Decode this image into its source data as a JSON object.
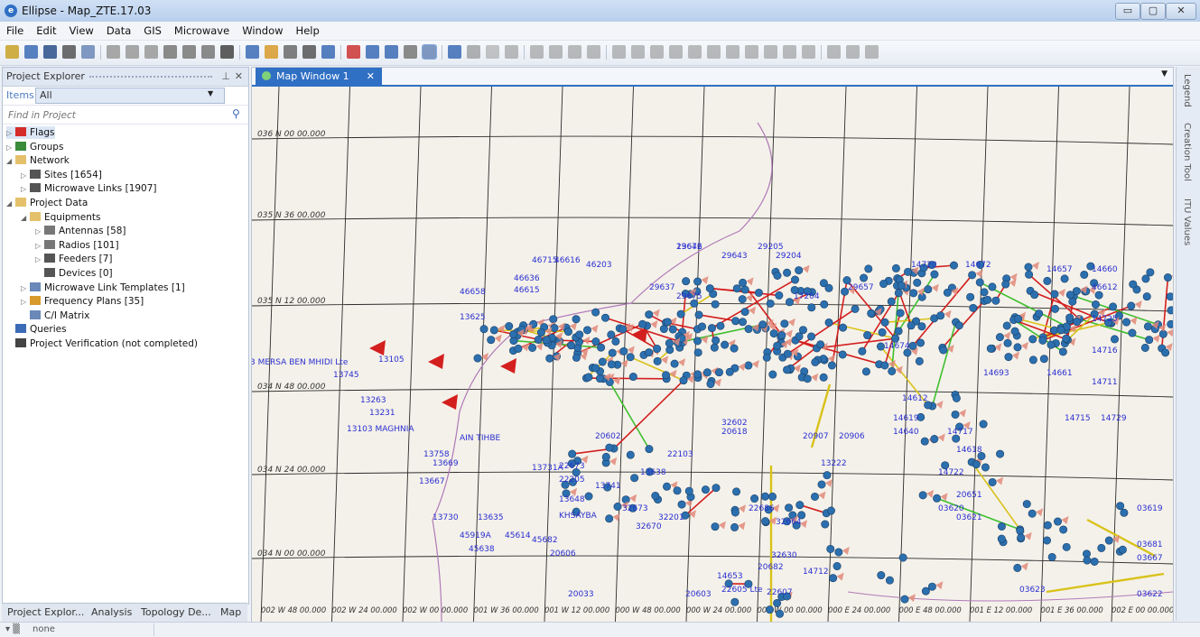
{
  "window": {
    "title": "Ellipse - Map_ZTE.17.03",
    "minimize": "▭",
    "restore": "▢",
    "close": "✕"
  },
  "menu": [
    "File",
    "Edit",
    "View",
    "Data",
    "GIS",
    "Microwave",
    "Window",
    "Help"
  ],
  "project_explorer": {
    "title": "Project Explorer",
    "items_label": "Items",
    "items_value": "All",
    "find_placeholder": "Find in Project",
    "tree": [
      {
        "label": "Flags",
        "icon": "flag-icon",
        "level": 0,
        "expanded": false,
        "selected": true
      },
      {
        "label": "Groups",
        "icon": "groups-icon",
        "level": 0,
        "expanded": false
      },
      {
        "label": "Network",
        "icon": "folder-icon",
        "level": 0,
        "expanded": true
      },
      {
        "label": "Sites [1654]",
        "icon": "site-icon",
        "level": 1,
        "expanded": false
      },
      {
        "label": "Microwave Links [1907]",
        "icon": "link-icon",
        "level": 1,
        "expanded": false
      },
      {
        "label": "Project Data",
        "icon": "folder-icon",
        "level": 0,
        "expanded": true
      },
      {
        "label": "Equipments",
        "icon": "folder-icon",
        "level": 1,
        "expanded": true
      },
      {
        "label": "Antennas [58]",
        "icon": "antenna-icon",
        "level": 2,
        "expanded": false
      },
      {
        "label": "Radios [101]",
        "icon": "radio-icon",
        "level": 2,
        "expanded": false
      },
      {
        "label": "Feeders [7]",
        "icon": "feeder-icon",
        "level": 2,
        "expanded": false
      },
      {
        "label": "Devices [0]",
        "icon": "device-icon",
        "level": 2,
        "leaf": true
      },
      {
        "label": "Microwave Link Templates [1]",
        "icon": "template-icon",
        "level": 1,
        "expanded": false
      },
      {
        "label": "Frequency Plans [35]",
        "icon": "frequency-icon",
        "level": 1,
        "expanded": false
      },
      {
        "label": "C/I Matrix",
        "icon": "matrix-icon",
        "level": 1,
        "leaf": true
      },
      {
        "label": "Queries",
        "icon": "queries-icon",
        "level": 0,
        "leaf": true
      },
      {
        "label": "Project Verification (not completed)",
        "icon": "wrench-icon",
        "level": 0,
        "leaf": true
      }
    ],
    "bottom_tabs": [
      "Project Explor...",
      "Analysis",
      "Topology De...",
      "Map"
    ]
  },
  "map_window": {
    "tab_label": "Map Window 1",
    "lat_labels": [
      "036 N 00 00.000",
      "035 N 36 00.000",
      "035 N 12 00.000",
      "034 N 48 00.000",
      "034 N 24 00.000",
      "034 N 00 00.000"
    ],
    "lon_labels": [
      "002 W 48 00.000",
      "002 W 24 00.000",
      "002 W 00 00.000",
      "001 W 36 00.000",
      "001 W 12 00.000",
      "000 W 48 00.000",
      "000 W 24 00.000",
      "000 W 00 00.000",
      "000 E 24 00.000",
      "000 E 48 00.000",
      "001 E 12 00.000",
      "001 E 36 00.000",
      "002 E 00 00.000"
    ],
    "site_labels": [
      "29676",
      "29643",
      "29205",
      "29204",
      "14720",
      "14672",
      "14657",
      "14660",
      "46715",
      "46616",
      "46203",
      "46636",
      "46615",
      "29637",
      "29675",
      "29657",
      "17204",
      "46612",
      "46658",
      "13625",
      "14674",
      "14725",
      "14716",
      "3 MERSA BEN MHIDI Lte",
      "13105",
      "13745",
      "13263",
      "13231",
      "13103 MAGHNIA",
      "14693",
      "14661",
      "14711",
      "14612",
      "14715",
      "14729",
      "14640",
      "14717",
      "14618",
      "20907",
      "20906",
      "20618",
      "20602",
      "22103",
      "22673",
      "22205",
      "13648",
      "KHSAYBA",
      "13638",
      "13741",
      "13731A",
      "13758",
      "13669",
      "13667",
      "13730",
      "13635",
      "45919A",
      "45682",
      "45614",
      "45638",
      "20606",
      "20033",
      "20603",
      "20682",
      "22607",
      "22605 Lte",
      "22686",
      "32673",
      "32670",
      "32201",
      "32664",
      "32630",
      "14653",
      "14712",
      "14722",
      "20651",
      "03621",
      "03620",
      "03681",
      "03667",
      "03622",
      "03619",
      "03623",
      "14619",
      "32602",
      "13222",
      "AIN TIHBE",
      "13642"
    ]
  },
  "right_dock": [
    "Legend",
    "Creation Tool",
    "ITU Values"
  ],
  "status": {
    "text": "none"
  },
  "colors": {
    "accent": "#2f6fc4",
    "link_red": "#d41f1f",
    "link_green": "#3fbf2f",
    "link_yellow": "#d9c21a",
    "site_blue": "#2b6fae",
    "label_blue": "#2a2fd0",
    "grid": "#2c2c2c",
    "boundary": "#b07ab8"
  }
}
